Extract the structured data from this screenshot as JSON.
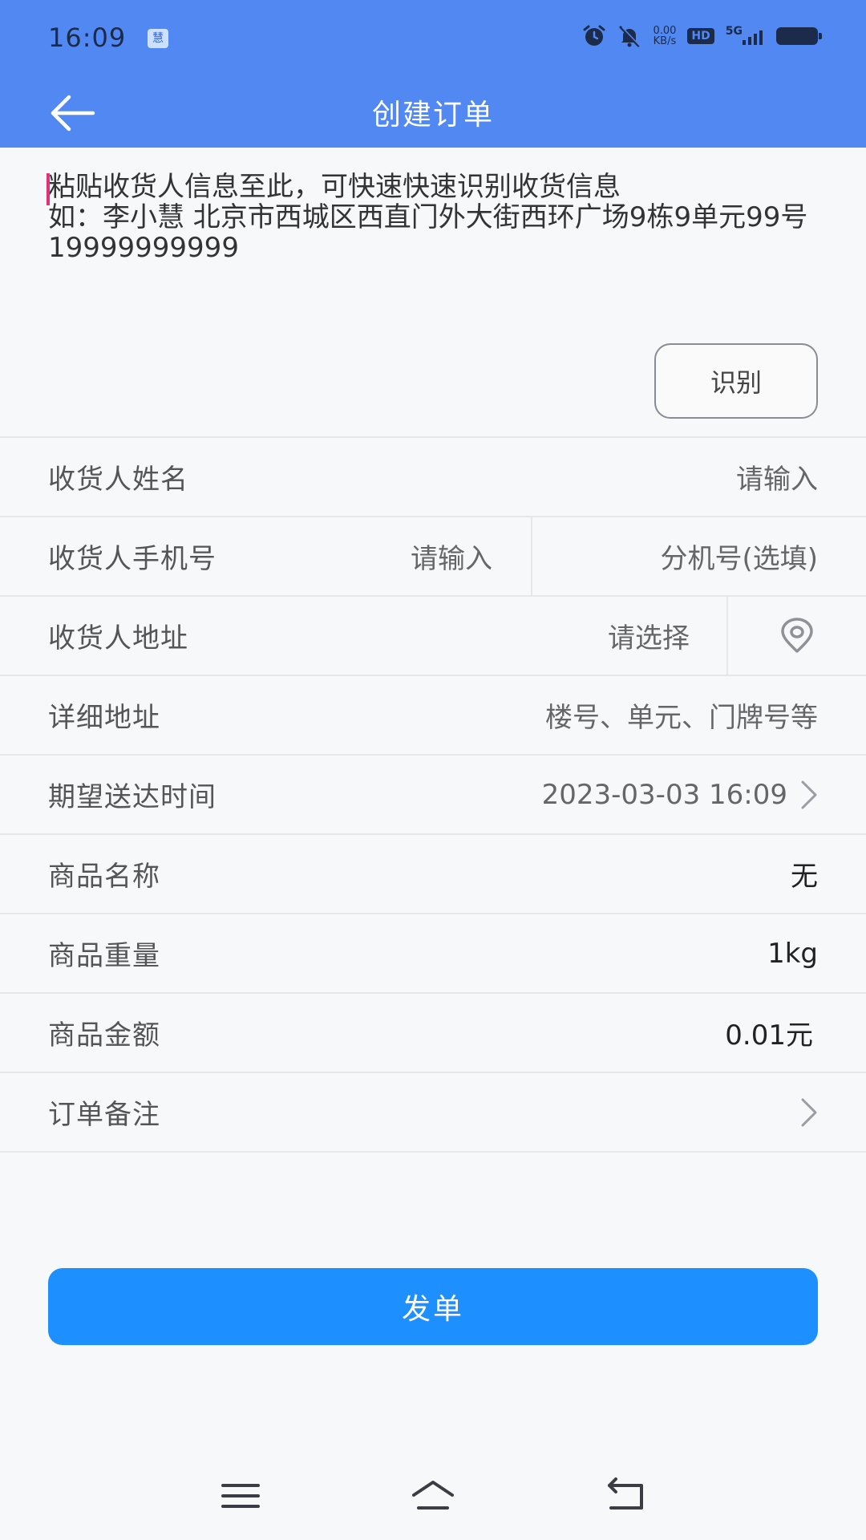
{
  "status_bar": {
    "time": "16:09",
    "app_indicator": "慧",
    "net_speed_value": "0.00",
    "net_speed_unit": "KB/s",
    "hd": "HD",
    "network": "5G"
  },
  "nav": {
    "title": "创建订单"
  },
  "paste": {
    "placeholder": "粘贴收货人信息至此，可快速快速识别收货信息\n如：李小慧 北京市西城区西直门外大街西环广场9栋9单元99号 19999999999",
    "recognize_label": "识别"
  },
  "form": {
    "name": {
      "label": "收货人姓名",
      "placeholder": "请输入"
    },
    "phone": {
      "label": "收货人手机号",
      "placeholder": "请输入",
      "extension_placeholder": "分机号(选填)"
    },
    "address": {
      "label": "收货人地址",
      "placeholder": "请选择"
    },
    "detail_address": {
      "label": "详细地址",
      "placeholder": "楼号、单元、门牌号等"
    },
    "delivery_time": {
      "label": "期望送达时间",
      "value": "2023-03-03 16:09"
    },
    "goods_name": {
      "label": "商品名称",
      "value": "无"
    },
    "goods_weight": {
      "label": "商品重量",
      "value": "1kg"
    },
    "goods_amount": {
      "label": "商品金额",
      "value": "0.01",
      "unit": "元"
    },
    "order_note": {
      "label": "订单备注"
    }
  },
  "submit_label": "发单",
  "colors": {
    "header": "#5288F2",
    "primary_button": "#1E8FFF",
    "cursor": "#E4307A"
  }
}
